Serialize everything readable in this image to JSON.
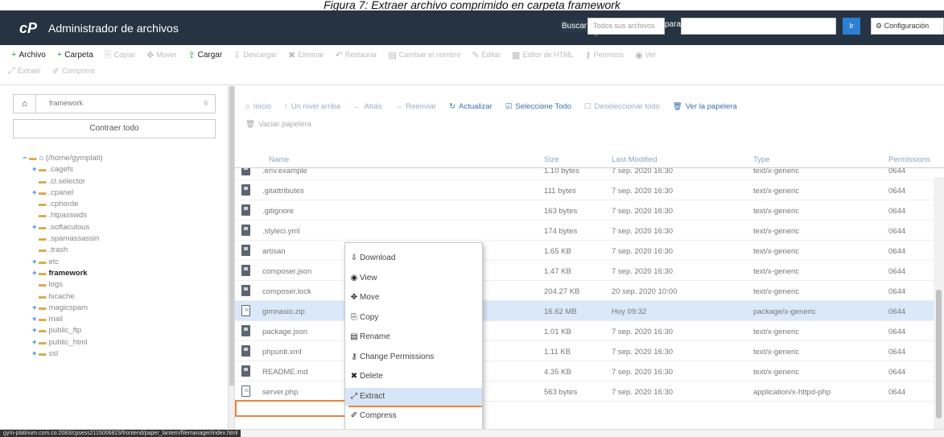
{
  "caption": "Figura 7: Extraer archivo comprimido en carpeta framework",
  "header": {
    "logo": "cP",
    "title": "Administrador de archivos",
    "search_label": "Buscar",
    "search_scope": "Todos sus archivos",
    "search_for_label": "para",
    "search_value": "",
    "go_label": "Ir",
    "settings_label": "Configuración"
  },
  "toolbar": {
    "row1": [
      {
        "icon": "+",
        "label": "Archivo",
        "active": true
      },
      {
        "icon": "+",
        "label": "Carpeta",
        "active": true
      },
      {
        "icon": "⎘",
        "label": "Copiar",
        "active": false
      },
      {
        "icon": "✥",
        "label": "Mover",
        "active": false
      },
      {
        "icon": "⇪",
        "label": "Cargar",
        "active": true
      },
      {
        "icon": "⇩",
        "label": "Descargar",
        "active": false
      },
      {
        "icon": "✖",
        "label": "Eliminar",
        "active": false
      },
      {
        "icon": "↶",
        "label": "Restaurar",
        "active": false
      },
      {
        "icon": "▤",
        "label": "Cambiar el nombre",
        "active": false
      },
      {
        "icon": "✎",
        "label": "Editar",
        "active": false
      },
      {
        "icon": "▦",
        "label": "Editor de HTML",
        "active": false
      },
      {
        "icon": "⚷",
        "label": "Permisos",
        "active": false
      },
      {
        "icon": "◉",
        "label": "Ver",
        "active": false
      }
    ],
    "row2": [
      {
        "icon": "⤢",
        "label": "Extraer",
        "active": false
      },
      {
        "icon": "✐",
        "label": "Comprimir",
        "active": false
      }
    ]
  },
  "sidebar": {
    "path_value": "framework",
    "path_go": "Ir",
    "collapse_label": "Contraer todo",
    "tree": [
      {
        "toggle": "−",
        "label": "(/home/gymplati)",
        "indent": 0,
        "current": false,
        "home": true
      },
      {
        "toggle": "+",
        "label": ".cagefs",
        "indent": 1,
        "current": false
      },
      {
        "toggle": "",
        "label": ".cl.selector",
        "indent": 1,
        "current": false
      },
      {
        "toggle": "+",
        "label": ".cpanel",
        "indent": 1,
        "current": false
      },
      {
        "toggle": "",
        "label": ".cphorde",
        "indent": 1,
        "current": false
      },
      {
        "toggle": "",
        "label": ".htpasswds",
        "indent": 1,
        "current": false
      },
      {
        "toggle": "+",
        "label": ".softaculous",
        "indent": 1,
        "current": false
      },
      {
        "toggle": "",
        "label": ".spamassassin",
        "indent": 1,
        "current": false
      },
      {
        "toggle": "",
        "label": ".trash",
        "indent": 1,
        "current": false
      },
      {
        "toggle": "+",
        "label": "etc",
        "indent": 1,
        "current": false
      },
      {
        "toggle": "+",
        "label": "framework",
        "indent": 1,
        "current": true
      },
      {
        "toggle": "",
        "label": "logs",
        "indent": 1,
        "current": false
      },
      {
        "toggle": "",
        "label": "lscache",
        "indent": 1,
        "current": false
      },
      {
        "toggle": "+",
        "label": "magicspam",
        "indent": 1,
        "current": false
      },
      {
        "toggle": "+",
        "label": "mail",
        "indent": 1,
        "current": false
      },
      {
        "toggle": "+",
        "label": "public_ftp",
        "indent": 1,
        "current": false
      },
      {
        "toggle": "+",
        "label": "public_html",
        "indent": 1,
        "current": false
      },
      {
        "toggle": "+",
        "label": "ssl",
        "indent": 1,
        "current": false
      }
    ]
  },
  "nav": {
    "row1": [
      {
        "icon": "⌂",
        "label": "Inicio"
      },
      {
        "icon": "↑",
        "label": "Un nivel arriba"
      },
      {
        "icon": "←",
        "label": "Atrás"
      },
      {
        "icon": "→",
        "label": "Reenviar"
      },
      {
        "icon": "↻",
        "label": "Actualizar"
      },
      {
        "icon": "☑",
        "label": "Seleccione Todo"
      },
      {
        "icon": "☐",
        "label": "Deseleccionar todo"
      },
      {
        "icon": "🗑",
        "label": "Ver la papelera"
      }
    ],
    "row2": [
      {
        "icon": "🗑",
        "label": "Vaciar papelera"
      }
    ]
  },
  "table": {
    "headers": [
      "Name",
      "Size",
      "Last Modified",
      "Type",
      "Permissions"
    ],
    "rows": [
      {
        "name": ".env.example",
        "size": "1.10 bytes",
        "modified": "7 sep. 2020 16:30",
        "type": "text/x-generic",
        "perms": "0644",
        "icon": "file"
      },
      {
        "name": ".gitattributes",
        "size": "111 bytes",
        "modified": "7 sep. 2020 16:30",
        "type": "text/x-generic",
        "perms": "0644",
        "icon": "file"
      },
      {
        "name": ".gitignore",
        "size": "163 bytes",
        "modified": "7 sep. 2020 16:30",
        "type": "text/x-generic",
        "perms": "0644",
        "icon": "file"
      },
      {
        "name": ".styleci.yml",
        "size": "174 bytes",
        "modified": "7 sep. 2020 16:30",
        "type": "text/x-generic",
        "perms": "0644",
        "icon": "file"
      },
      {
        "name": "artisan",
        "size": "1.65 KB",
        "modified": "7 sep. 2020 16:30",
        "type": "text/x-generic",
        "perms": "0644",
        "icon": "file"
      },
      {
        "name": "composer.json",
        "size": "1.47 KB",
        "modified": "7 sep. 2020 16:30",
        "type": "text/x-generic",
        "perms": "0644",
        "icon": "file"
      },
      {
        "name": "composer.lock",
        "size": "204.27 KB",
        "modified": "20 sep. 2020 10:00",
        "type": "text/x-generic",
        "perms": "0644",
        "icon": "file"
      },
      {
        "name": "gimnasio.zip",
        "size": "16.62 MB",
        "modified": "Hoy 09:32",
        "type": "package/x-generic",
        "perms": "0644",
        "icon": "zip",
        "selected": true
      },
      {
        "name": "package.json",
        "size": "1.01 KB",
        "modified": "7 sep. 2020 16:30",
        "type": "text/x-generic",
        "perms": "0644",
        "icon": "file"
      },
      {
        "name": "phpunit.xml",
        "size": "1.11 KB",
        "modified": "7 sep. 2020 16:30",
        "type": "text/x-generic",
        "perms": "0644",
        "icon": "file"
      },
      {
        "name": "README.md",
        "size": "4.35 KB",
        "modified": "7 sep. 2020 16:30",
        "type": "text/x-generic",
        "perms": "0644",
        "icon": "file"
      },
      {
        "name": "server.php",
        "size": "563 bytes",
        "modified": "7 sep. 2020 16:30",
        "type": "application/x-httpd-php",
        "perms": "0644",
        "icon": "php"
      }
    ]
  },
  "context_menu": [
    {
      "icon": "⇩",
      "label": "Download",
      "active": false
    },
    {
      "icon": "◉",
      "label": "View",
      "active": false
    },
    {
      "icon": "✥",
      "label": "Move",
      "active": false
    },
    {
      "icon": "⎘",
      "label": "Copy",
      "active": false
    },
    {
      "icon": "▤",
      "label": "Rename",
      "active": false
    },
    {
      "icon": "⚷",
      "label": "Change Permissions",
      "active": false
    },
    {
      "icon": "✖",
      "label": "Delete",
      "active": false
    },
    {
      "icon": "⤢",
      "label": "Extract",
      "active": true
    },
    {
      "icon": "✐",
      "label": "Compress",
      "active": false
    }
  ],
  "status_url": "gym-platinum.com.co:2083/cpsess2115006823/frontend/paper_lantern/filemanager/index.html",
  "colors": {
    "header_bg": "#253342",
    "accent": "#2d7fd3",
    "highlight": "#e8863c",
    "selected_row": "#d9e9f9"
  }
}
